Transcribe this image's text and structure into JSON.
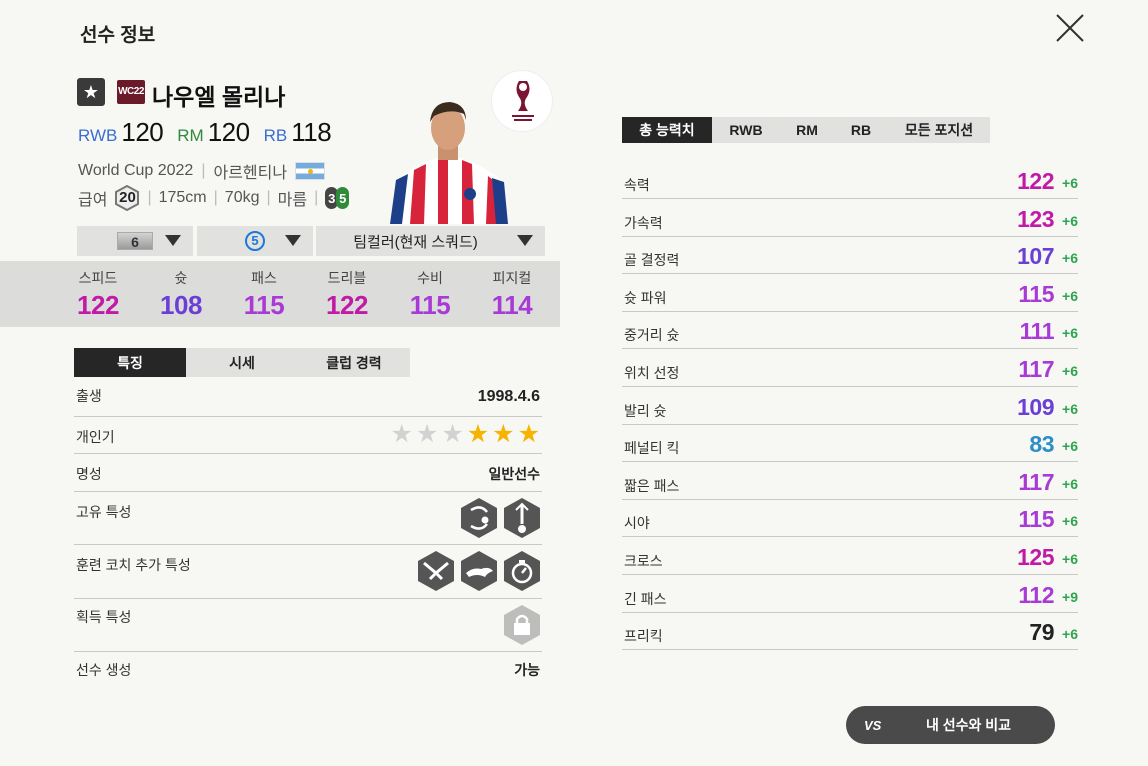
{
  "page": {
    "title": "선수 정보"
  },
  "player": {
    "name": "나우엘 몰리나",
    "season_badge": "WC22",
    "positions": [
      {
        "pos": "RWB",
        "ovr": "120",
        "color": "#3a6ed0"
      },
      {
        "pos": "RM",
        "ovr": "120",
        "color": "#2f8a3c"
      },
      {
        "pos": "RB",
        "ovr": "118",
        "color": "#3a6ed0"
      }
    ],
    "season": "World Cup 2022",
    "nation": "아르헨티나",
    "salary_label": "급여",
    "salary": "20",
    "height": "175cm",
    "weight": "70kg",
    "body": "마름",
    "left_foot": "3",
    "right_foot": "5"
  },
  "selectors": {
    "level": "6",
    "grade": "5",
    "team_color": "팀컬러(현재 스쿼드)"
  },
  "summary": [
    {
      "label": "스피드",
      "value": "122",
      "color": "#c01aa6"
    },
    {
      "label": "슛",
      "value": "108",
      "color": "#6b3fd6"
    },
    {
      "label": "패스",
      "value": "115",
      "color": "#a83ad6"
    },
    {
      "label": "드리블",
      "value": "122",
      "color": "#c01aa6"
    },
    {
      "label": "수비",
      "value": "115",
      "color": "#a83ad6"
    },
    {
      "label": "피지컬",
      "value": "114",
      "color": "#a83ad6"
    }
  ],
  "tabs": [
    "특징",
    "시세",
    "클럽 경력"
  ],
  "info": {
    "birth_label": "출생",
    "birth": "1998.4.6",
    "skill_label": "개인기",
    "skill_stars": 3,
    "stars_total": 6,
    "fame_label": "명성",
    "fame": "일반선수",
    "unique_traits_label": "고유 특성",
    "coach_traits_label": "훈련 코치 추가 특성",
    "acquired_traits_label": "획득 특성",
    "creation_label": "선수 생성",
    "creation": "가능"
  },
  "stat_tabs": [
    "총 능력치",
    "RWB",
    "RM",
    "RB",
    "모든 포지션"
  ],
  "stats": [
    {
      "label": "속력",
      "value": "122",
      "bonus": "+6",
      "color": "#c01aa6"
    },
    {
      "label": "가속력",
      "value": "123",
      "bonus": "+6",
      "color": "#c01aa6"
    },
    {
      "label": "골 결정력",
      "value": "107",
      "bonus": "+6",
      "color": "#6b3fd6"
    },
    {
      "label": "슛 파워",
      "value": "115",
      "bonus": "+6",
      "color": "#a83ad6"
    },
    {
      "label": "중거리 슛",
      "value": "111",
      "bonus": "+6",
      "color": "#a83ad6"
    },
    {
      "label": "위치 선정",
      "value": "117",
      "bonus": "+6",
      "color": "#a83ad6"
    },
    {
      "label": "발리 슛",
      "value": "109",
      "bonus": "+6",
      "color": "#6b3fd6"
    },
    {
      "label": "페널티 킥",
      "value": "83",
      "bonus": "+6",
      "color": "#2b8fc6"
    },
    {
      "label": "짧은 패스",
      "value": "117",
      "bonus": "+6",
      "color": "#a83ad6"
    },
    {
      "label": "시야",
      "value": "115",
      "bonus": "+6",
      "color": "#a83ad6"
    },
    {
      "label": "크로스",
      "value": "125",
      "bonus": "+6",
      "color": "#c01aa6"
    },
    {
      "label": "긴 패스",
      "value": "112",
      "bonus": "+9",
      "color": "#a83ad6"
    },
    {
      "label": "프리킥",
      "value": "79",
      "bonus": "+6",
      "color": "#222222"
    }
  ],
  "compare": {
    "vs": "VS",
    "label": "내 선수와 비교"
  },
  "icons": {
    "close": "close-icon",
    "star": "star-icon",
    "trait": "hexagon-trait-icon",
    "lock": "lock-icon",
    "world_cup_logo": "world-cup-logo",
    "flag": "argentina-flag-icon"
  }
}
